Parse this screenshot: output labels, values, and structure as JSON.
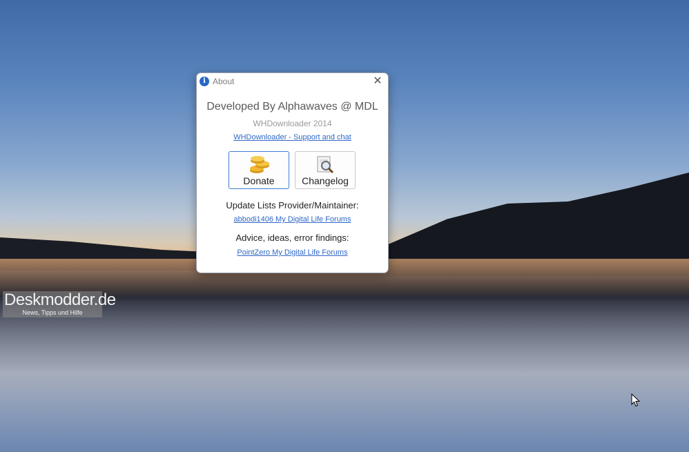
{
  "desktop": {
    "watermark_title": "Deskmodder.de",
    "watermark_subtitle": "News, Tipps und Hilfe"
  },
  "dialog": {
    "title": "About",
    "close_symbol": "✕",
    "developer": "Developed By Alphawaves @ MDL",
    "app_version": "WHDownloader 2014",
    "support_link": "WHDownloader - Support and chat",
    "donate_label": "Donate",
    "changelog_label": "Changelog",
    "update_heading": "Update Lists Provider/Maintainer:",
    "update_link": "abbodi1406 My Digital Life Forums",
    "advice_heading": "Advice, ideas, error findings:",
    "advice_link": "PointZero My Digital Life Forums"
  },
  "icons": {
    "title": "info-icon",
    "donate": "coins-icon",
    "changelog": "magnifier-document-icon",
    "close": "close-icon"
  },
  "colors": {
    "accent": "#3f7cd1",
    "link": "#2f67c7",
    "info_icon": "#2a66c6",
    "coins": "#f2b82f"
  }
}
